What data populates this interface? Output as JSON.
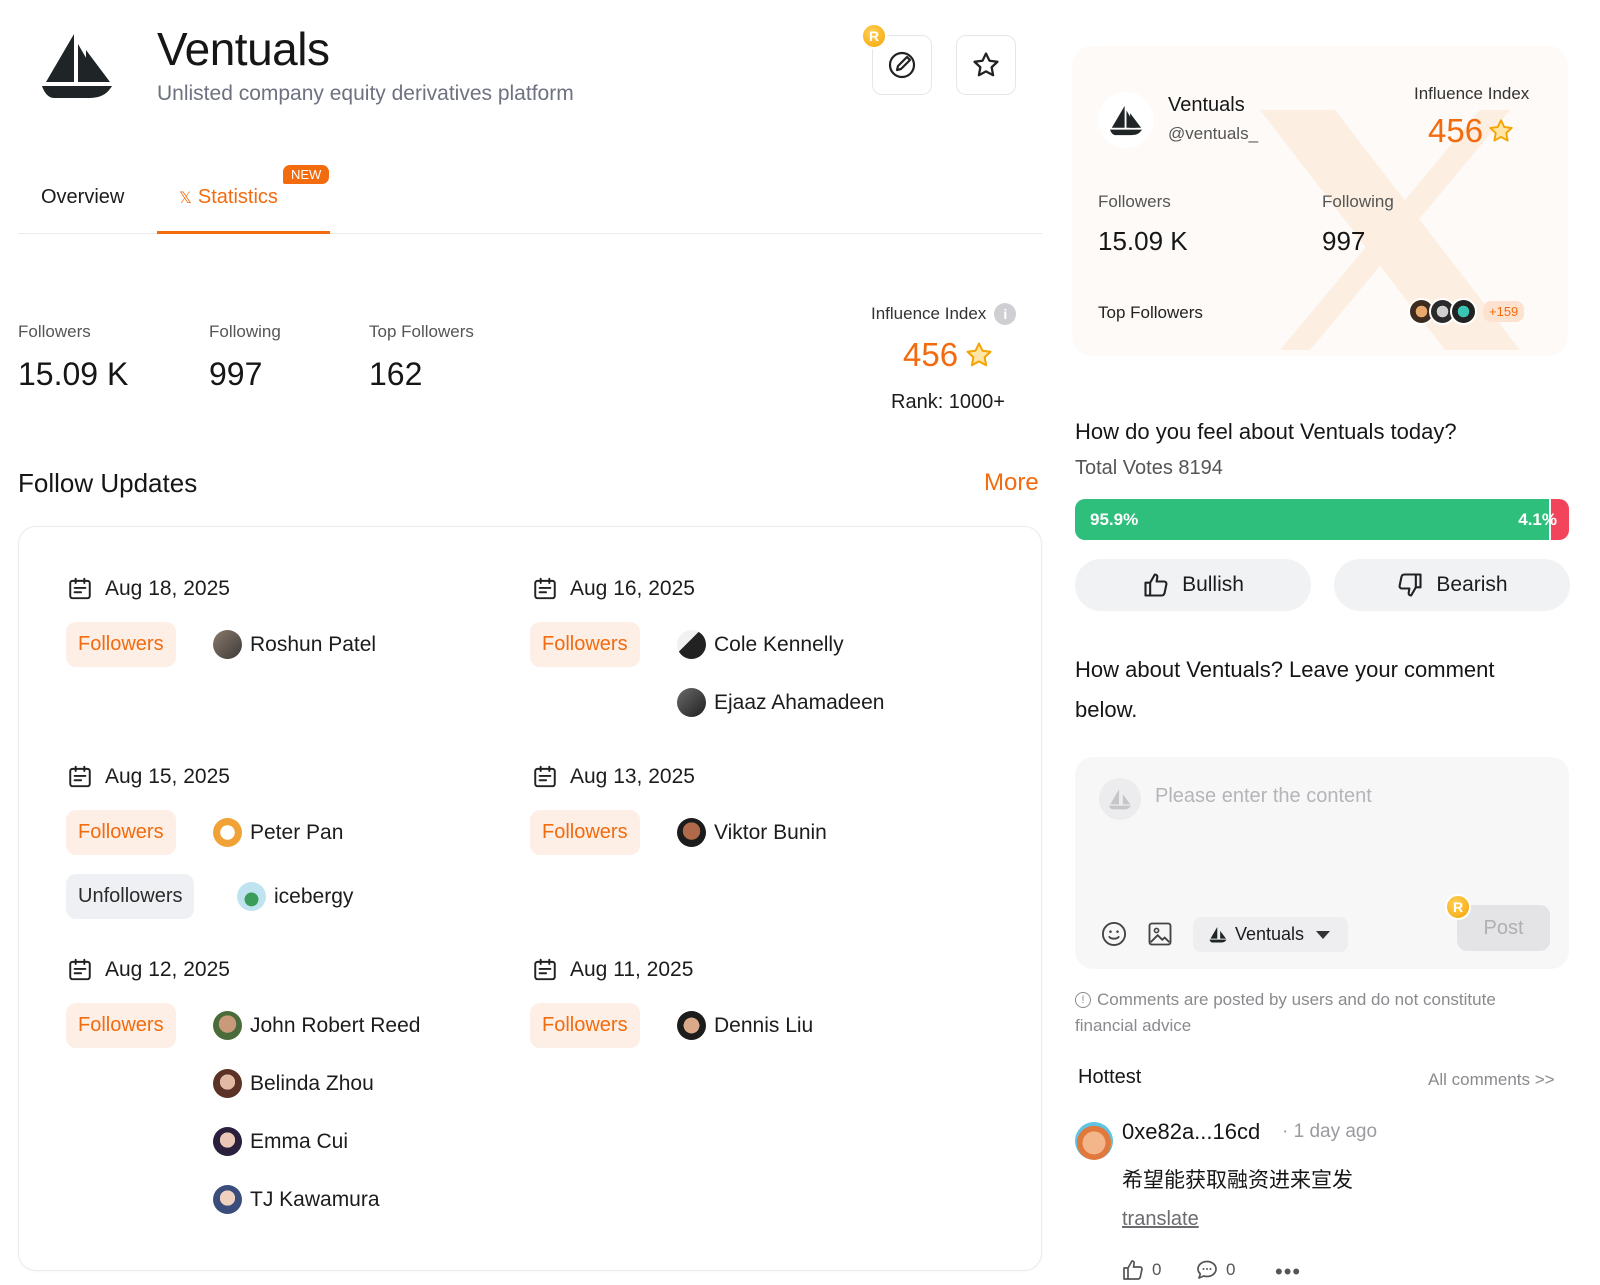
{
  "project": {
    "name": "Ventuals",
    "tagline": "Unlisted company equity derivatives platform",
    "coin_label": "R"
  },
  "tabs": [
    {
      "label": "Overview",
      "active": false
    },
    {
      "label": "Statistics",
      "active": true,
      "badge": "NEW",
      "prefix": "𝕏"
    }
  ],
  "stats": {
    "followers_label": "Followers",
    "followers_value": "15.09 K",
    "following_label": "Following",
    "following_value": "997",
    "top_followers_label": "Top Followers",
    "top_followers_value": "162",
    "influence_label": "Influence Index",
    "influence_value": "456",
    "rank": "Rank: 1000+"
  },
  "follow_updates": {
    "title": "Follow Updates",
    "more": "More",
    "groups": [
      {
        "date": "Aug 18, 2025",
        "type": "Followers",
        "people": [
          "Roshun Patel"
        ]
      },
      {
        "date": "Aug 16, 2025",
        "type": "Followers",
        "people": [
          "Cole Kennelly",
          "Ejaaz Ahamadeen"
        ]
      },
      {
        "date": "Aug 15, 2025",
        "type": "Followers",
        "people": [
          "Peter Pan"
        ],
        "type2": "Unfollowers",
        "people2": [
          "icebergy"
        ]
      },
      {
        "date": "Aug 13, 2025",
        "type": "Followers",
        "people": [
          "Viktor Bunin"
        ]
      },
      {
        "date": "Aug 12, 2025",
        "type": "Followers",
        "people": [
          "John Robert Reed",
          "Belinda Zhou",
          "Emma Cui",
          "TJ Kawamura"
        ]
      },
      {
        "date": "Aug 11, 2025",
        "type": "Followers",
        "people": [
          "Dennis Liu"
        ]
      }
    ]
  },
  "profile_card": {
    "name": "Ventuals",
    "handle": "@ventuals_",
    "influence_label": "Influence Index",
    "influence_value": "456",
    "followers_label": "Followers",
    "followers_value": "15.09 K",
    "following_label": "Following",
    "following_value": "997",
    "top_followers_label": "Top Followers",
    "top_followers_more": "+159"
  },
  "poll": {
    "question": "How do you feel about Ventuals today?",
    "total_votes": "Total Votes 8194",
    "bullish_pct": "95.9%",
    "bearish_pct": "4.1%",
    "bullish_share": 0.959,
    "bullish_label": "Bullish",
    "bearish_label": "Bearish"
  },
  "comment": {
    "prompt_line1": "How about Ventuals? Leave your comment",
    "prompt_line2": "below.",
    "placeholder": "Please enter the content",
    "selector": "Ventuals",
    "post": "Post",
    "disclaimer_line1": "Comments are posted by users and do not constitute",
    "disclaimer_line2": "financial advice"
  },
  "hottest": {
    "label": "Hottest",
    "all_link": "All comments >>",
    "items": [
      {
        "user": "0xe82a...16cd",
        "time": "· 1 day ago",
        "text": "希望能获取融资进来宣发",
        "translate": "translate",
        "likes": "0",
        "replies": "0"
      }
    ]
  },
  "colors": {
    "accent": "#f26b0f",
    "bullish": "#2fbf7d",
    "bearish": "#f2455c"
  }
}
